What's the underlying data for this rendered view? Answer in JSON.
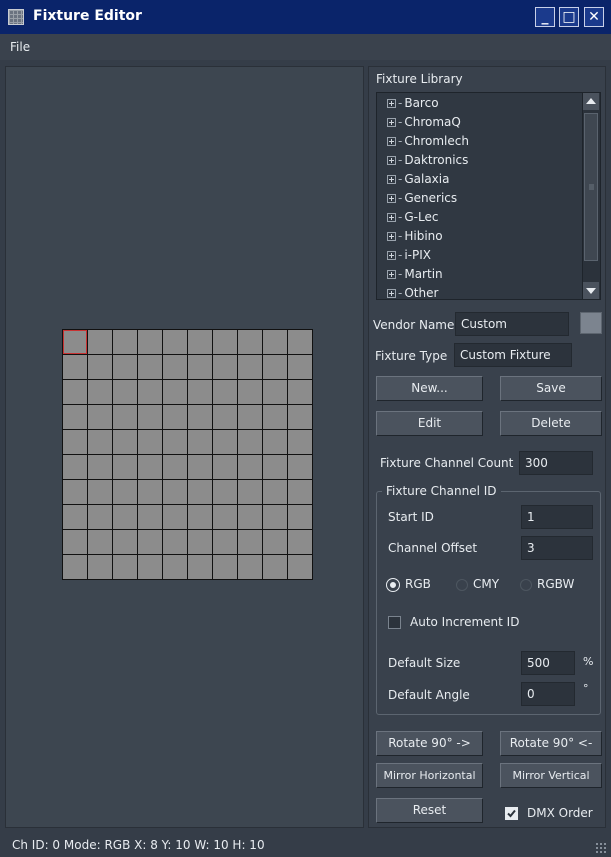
{
  "window": {
    "title": "Fixture Editor",
    "minimize": "_",
    "maximize": "□",
    "close": "✕"
  },
  "menu": {
    "file": "File"
  },
  "library": {
    "title": "Fixture Library",
    "items": [
      "Barco",
      "ChromaQ",
      "Chromlech",
      "Daktronics",
      "Galaxia",
      "Generics",
      "G-Lec",
      "Hibino",
      "i-PIX",
      "Martin",
      "Other"
    ]
  },
  "vendor": {
    "label": "Vendor Name",
    "value": "Custom"
  },
  "fixture_type": {
    "label": "Fixture Type",
    "value": "Custom Fixture"
  },
  "buttons": {
    "new": "New...",
    "save": "Save",
    "edit": "Edit",
    "delete": "Delete",
    "rotate_cw": "Rotate 90° ->",
    "rotate_ccw": "Rotate 90° <-",
    "mirror_h": "Mirror Horizontal",
    "mirror_v": "Mirror Vertical",
    "reset": "Reset"
  },
  "channel_count": {
    "label": "Fixture Channel Count",
    "value": "300"
  },
  "channel_id": {
    "group_title": "Fixture Channel ID",
    "start_label": "Start ID",
    "start_value": "1",
    "offset_label": "Channel Offset",
    "offset_value": "3",
    "modes": [
      "RGB",
      "CMY",
      "RGBW"
    ],
    "selected_mode": "RGB",
    "auto_increment": "Auto Increment ID",
    "size_label": "Default Size",
    "size_value": "500",
    "size_unit": "%",
    "angle_label": "Default Angle",
    "angle_value": "0",
    "angle_unit": "°"
  },
  "dmx_order": {
    "label": "DMX Order",
    "checked": true
  },
  "grid": {
    "columns": 10,
    "rows": 10
  },
  "status": "Ch ID: 0  Mode: RGB  X: 8  Y: 10  W: 10  H: 10",
  "colors": {
    "title_bar": "#0a246a",
    "background": "#353d48",
    "cell": "#8c8c8c",
    "selected_cell_border": "#c83232"
  }
}
